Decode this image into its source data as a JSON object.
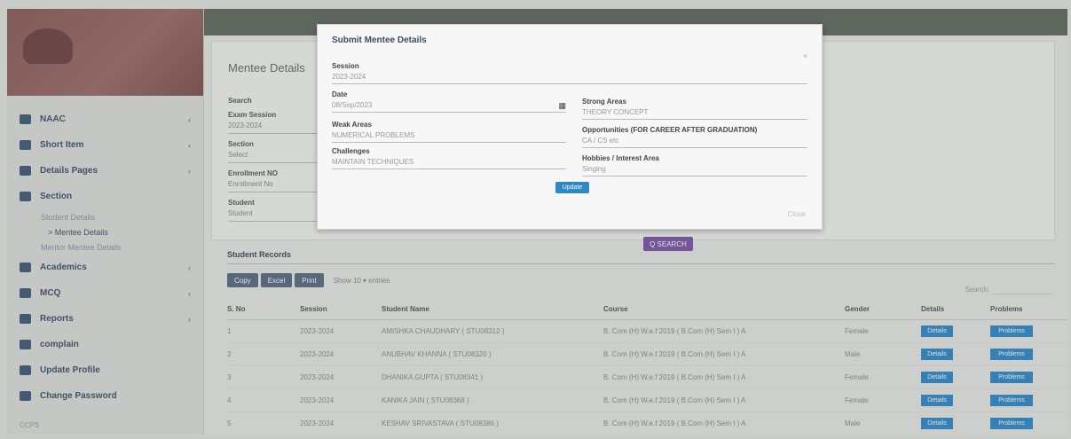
{
  "sidebar": {
    "items": [
      {
        "label": "NAAC",
        "chevron": "‹"
      },
      {
        "label": "Short Item",
        "chevron": "‹"
      },
      {
        "label": "Details Pages",
        "chevron": "‹"
      },
      {
        "label": "Section",
        "chevron": ""
      }
    ],
    "subitems": [
      {
        "label": "Student Details"
      },
      {
        "label": "> Mentee Details"
      },
      {
        "label": "Mentor Mentee Details"
      }
    ],
    "items2": [
      {
        "label": "Academics",
        "chevron": "‹"
      },
      {
        "label": "MCQ",
        "chevron": "‹"
      },
      {
        "label": "Reports",
        "chevron": "‹"
      },
      {
        "label": "complain",
        "chevron": ""
      },
      {
        "label": "Update Profile",
        "chevron": ""
      },
      {
        "label": "Change Password",
        "chevron": ""
      }
    ],
    "footer": "CCPS"
  },
  "page": {
    "title": "Mentee Details",
    "fields": [
      {
        "label": "Search",
        "value": ""
      },
      {
        "label": "Exam Session",
        "value": "2023-2024"
      },
      {
        "label": "Section",
        "value": "Select"
      },
      {
        "label": "Enrollment NO",
        "value": "Enrollment No"
      },
      {
        "label": "Student",
        "value": "Student"
      }
    ],
    "search_button": "Q SEARCH"
  },
  "records": {
    "title": "Student Records",
    "buttons": [
      "Copy",
      "Excel",
      "Print"
    ],
    "show_text": "Show  10  ▾ entries",
    "search_label": "Search:",
    "columns": [
      "S. No",
      "Session",
      "Student Name",
      "Course",
      "Gender",
      "Details",
      "Problems"
    ],
    "rows": [
      {
        "sno": "1",
        "session": "2023-2024",
        "name": "AMISHKA CHAUDHARY ( STU08312 )",
        "course": "B. Com (H) W.e.f 2019 ( B.Com (H) Sem I ) A",
        "gender": "Female",
        "details": "Details",
        "problems": "Problems"
      },
      {
        "sno": "2",
        "session": "2023-2024",
        "name": "ANUBHAV KHANNA ( STU08320 )",
        "course": "B. Com (H) W.e.f 2019 ( B.Com (H) Sem I ) A",
        "gender": "Male",
        "details": "Details",
        "problems": "Problems"
      },
      {
        "sno": "3",
        "session": "2023-2024",
        "name": "DHANIKA GUPTA ( STU08341 )",
        "course": "B. Com (H) W.e.f 2019 ( B.Com (H) Sem I ) A",
        "gender": "Female",
        "details": "Details",
        "problems": "Problems"
      },
      {
        "sno": "4",
        "session": "2023-2024",
        "name": "KANIKA JAIN ( STU08368 )",
        "course": "B. Com (H) W.e.f 2019 ( B.Com (H) Sem I ) A",
        "gender": "Female",
        "details": "Details",
        "problems": "Problems"
      },
      {
        "sno": "5",
        "session": "2023-2024",
        "name": "KESHAV SRIVASTAVA ( STU08386 )",
        "course": "B. Com (H) W.e.f 2019 ( B.Com (H) Sem I ) A",
        "gender": "Male",
        "details": "Details",
        "problems": "Problems"
      }
    ]
  },
  "modal": {
    "title": "Submit Mentee Details",
    "session_label": "Session",
    "session_value": "2023-2024",
    "date_label": "Date",
    "date_value": "08/Sep/2023",
    "weak_label": "Weak Areas",
    "weak_value": "NUMERICAL PROBLEMS",
    "challenges_label": "Challenges",
    "challenges_value": "MAINTAIN TECHNIQUES",
    "strong_label": "Strong Areas",
    "strong_value": "THEORY CONCEPT",
    "opportunities_label": "Opportunities (FOR CAREER AFTER GRADUATION)",
    "opportunities_value": "CA / CS etc",
    "hobbies_label": "Hobbies / Interest Area",
    "hobbies_value": "Singing",
    "update_button": "Update",
    "close_button": "Close"
  },
  "colors": {
    "accent_blue": "#2e88c8",
    "search_purple": "#7a54a8",
    "logo_bg": "#8a5a5a"
  }
}
